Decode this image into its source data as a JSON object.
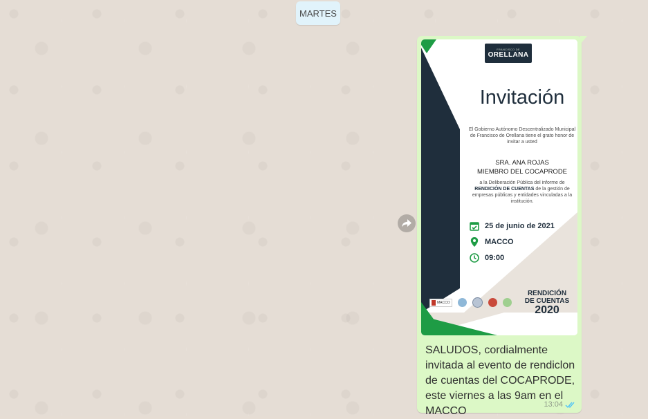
{
  "chat": {
    "date_label": "MARTES"
  },
  "message": {
    "caption": "SALUDOS, cordialmente invitada al evento de rendiclon de cuentas del COCAPRODE,  este viernes a las 9am en el MACCO",
    "time": "13:04",
    "status_icon": "double-check-icon",
    "status_color": "#4fc3f7"
  },
  "invitation": {
    "logo_small": "FRANCISCO DE",
    "logo_main": "ORELLANA",
    "title": "Invitación",
    "intro": "El Gobierno Autónomo Descentralizado Municipal de Francisco de Orellana tiene el grato honor de invitar a usted",
    "guest_name": "SRA. ANA ROJAS",
    "guest_role": "MIEMBRO DEL COCAPRODE",
    "body_pre": "a la Deliberación Pública del informe de",
    "body_bold": "RENDICIÓN DE CUENTAS",
    "body_post": "de la gestión de empresas públicas y entidades vinculadas a la institución.",
    "date": "25 de junio de 2021",
    "place": "MACCO",
    "time": "09:00",
    "badge_line1": "RENDICIÓN",
    "badge_line2": "DE CUENTAS",
    "badge_year": "2020",
    "sponsor_macco": "MACCO"
  },
  "colors": {
    "bubble": "#dcf8c6",
    "navy": "#1f2e3c",
    "green": "#1e9c45",
    "beige": "#e9e3dc"
  }
}
